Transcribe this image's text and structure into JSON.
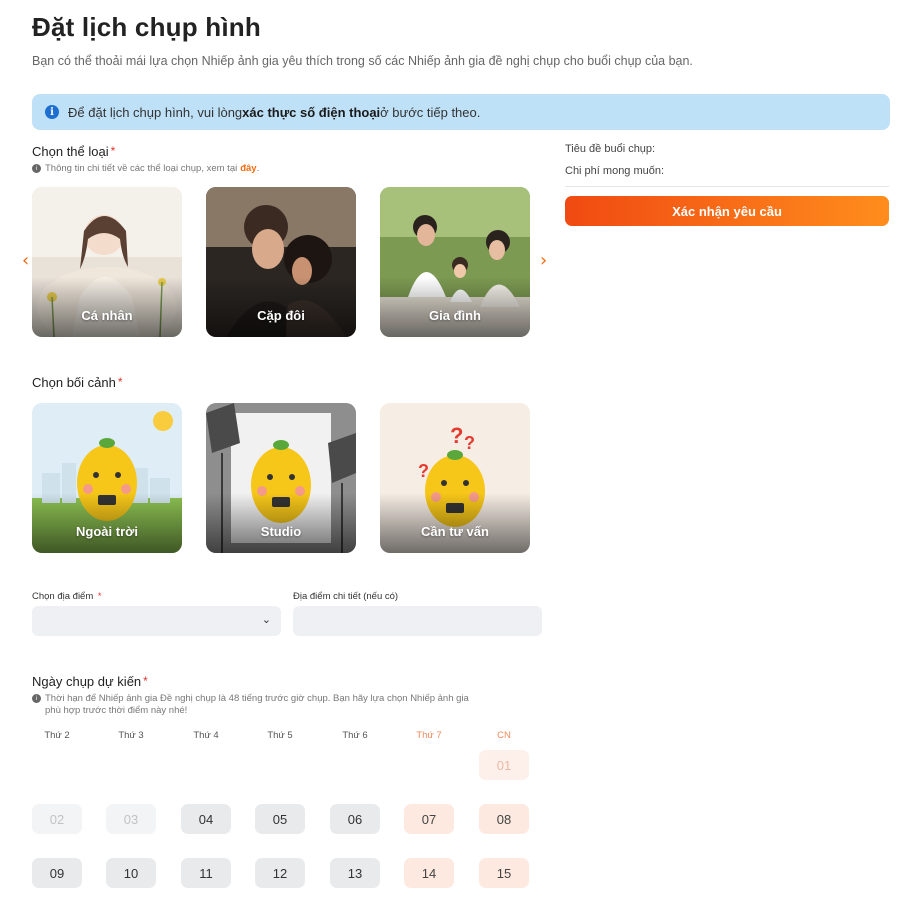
{
  "page": {
    "title": "Đặt lịch chụp hình",
    "subtitle": "Bạn có thể thoải mái lựa chọn Nhiếp ảnh gia yêu thích trong số các Nhiếp ảnh gia đề nghị chụp cho buổi chụp của bạn."
  },
  "notice": {
    "prefix": "Để đặt lịch chụp hình, vui lòng ",
    "bold": "xác thực số điện thoại",
    "suffix": " ở bước tiếp theo."
  },
  "genre": {
    "label": "Chọn thể loại",
    "required_mark": "*",
    "hint_text": "Thông tin chi tiết về các thể loại chụp, xem tại",
    "hint_link": "đây",
    "hint_end": ".",
    "cards": [
      {
        "label": "Cá nhân"
      },
      {
        "label": "Cặp đôi"
      },
      {
        "label": "Gia đình"
      }
    ]
  },
  "context": {
    "label": "Chọn bối cảnh",
    "required_mark": "*",
    "cards": [
      {
        "label": "Ngoài trời"
      },
      {
        "label": "Studio"
      },
      {
        "label": "Cần tư vấn"
      }
    ]
  },
  "location": {
    "label": "Chọn địa điểm",
    "required_mark": "*",
    "detail_label": "Địa điểm chi tiết (nếu có)"
  },
  "date": {
    "label": "Ngày chụp dự kiến",
    "required_mark": "*",
    "hint_line1": "Thời hạn để Nhiếp ảnh gia Đề nghị chụp là 48 tiếng trước giờ chụp. Bạn hãy lựa chọn Nhiếp ảnh gia",
    "hint_line2": "phù hợp trước thời điểm này nhé!",
    "weekdays": [
      "Thứ 2",
      "Thứ 3",
      "Thứ 4",
      "Thứ 5",
      "Thứ 6",
      "Thứ 7",
      "CN"
    ],
    "rows": [
      [
        "",
        "",
        "",
        "",
        "",
        "",
        "01"
      ],
      [
        "02",
        "03",
        "04",
        "05",
        "06",
        "07",
        "08"
      ],
      [
        "09",
        "10",
        "11",
        "12",
        "13",
        "14",
        "15"
      ]
    ]
  },
  "summary": {
    "session_title_label": "Tiêu đề buổi chụp:",
    "expected_cost_label": "Chi phí mong muốn:",
    "confirm_label": "Xác nhận yêu cầu"
  },
  "colors": {
    "accent": "#f26b0f",
    "notice_bg": "#bfe1f7",
    "required": "#e5322d"
  }
}
